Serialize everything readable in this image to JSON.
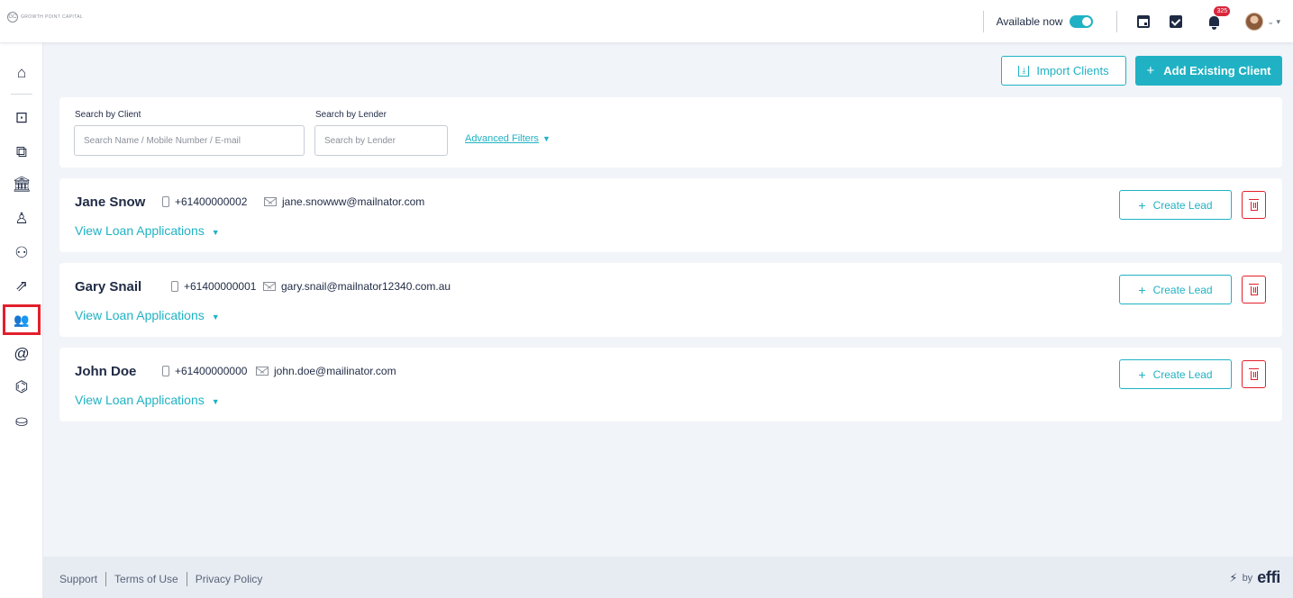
{
  "brand": {
    "logo_text": "GROWTH POINT CAPITAL",
    "logo_mark": "GC"
  },
  "topbar": {
    "availability_label": "Available now",
    "availability_on": true,
    "notification_count": "325",
    "caret": "⌄ ▾"
  },
  "sidebar": {
    "items": [
      {
        "name": "home",
        "icon": "⌂"
      },
      {
        "name": "briefcase-id",
        "icon": "⊡"
      },
      {
        "name": "briefcase-plus",
        "icon": "⧉"
      },
      {
        "name": "bank",
        "icon": "🏛"
      },
      {
        "name": "hierarchy",
        "icon": "♙"
      },
      {
        "name": "team",
        "icon": "⚇"
      },
      {
        "name": "growth",
        "icon": "⇗"
      },
      {
        "name": "clients",
        "icon": "👥",
        "active": true
      },
      {
        "name": "at-sign",
        "icon": "@"
      },
      {
        "name": "robot",
        "icon": "⌬"
      },
      {
        "name": "hand-coins",
        "icon": "⛀"
      }
    ]
  },
  "actions": {
    "import_label": "Import Clients",
    "import_icon": "⤓",
    "add_label": "Add Existing Client",
    "add_icon": "+"
  },
  "filters": {
    "client_label": "Search by Client",
    "client_placeholder": "Search Name / Mobile Number / E-mail",
    "lender_label": "Search by Lender",
    "lender_placeholder": "Search by Lender",
    "advanced_label": "Advanced Filters",
    "advanced_caret": "▼"
  },
  "clients": [
    {
      "name": "Jane Snow",
      "phone": "+61400000002",
      "email": "jane.snowww@mailnator.com",
      "view_label": "View Loan Applications",
      "lead_label": "Create Lead"
    },
    {
      "name": "Gary Snail",
      "phone": "+61400000001",
      "email": "gary.snail@mailnator12340.com.au",
      "view_label": "View Loan Applications",
      "lead_label": "Create Lead"
    },
    {
      "name": "John Doe",
      "phone": "+61400000000",
      "email": "john.doe@mailinator.com",
      "view_label": "View Loan Applications",
      "lead_label": "Create Lead"
    }
  ],
  "footer": {
    "links": [
      "Support",
      "Terms of Use",
      "Privacy Policy"
    ],
    "powered_by": "by",
    "powered_brand": "effi"
  },
  "colors": {
    "accent": "#20b2c4",
    "danger": "#e2202c",
    "text": "#1f2a44",
    "background": "#f1f4f8"
  }
}
